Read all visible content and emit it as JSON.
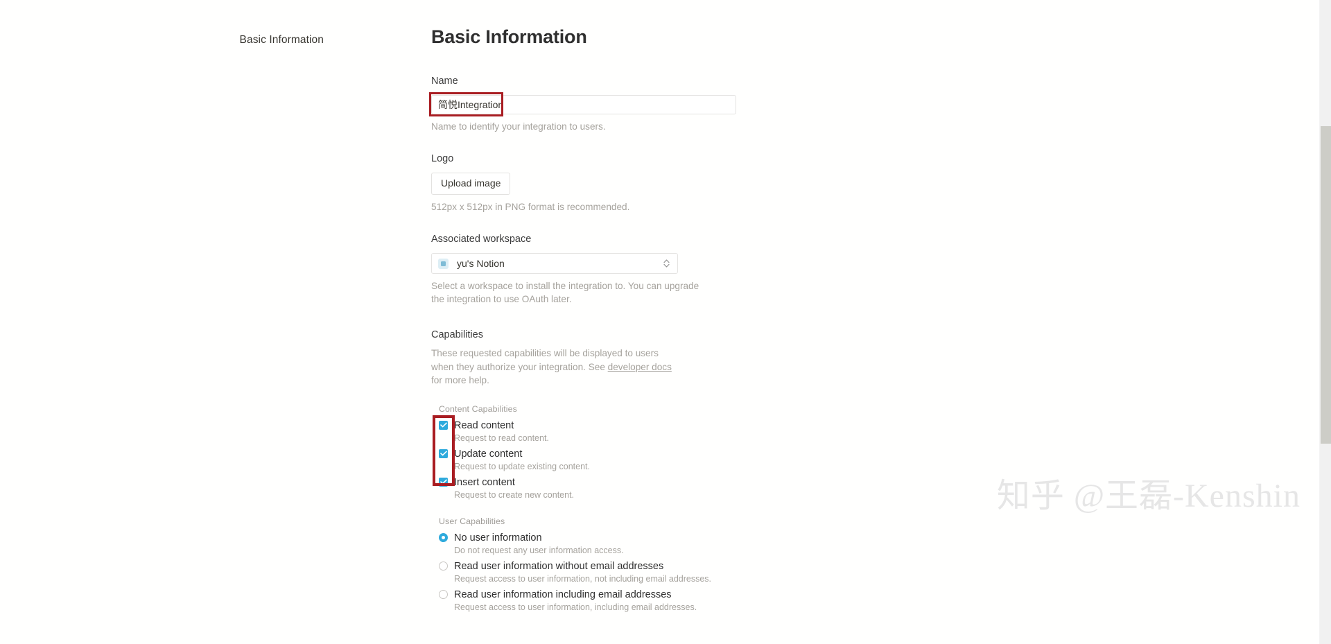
{
  "sidebar": {
    "items": [
      {
        "label": "Basic Information"
      }
    ]
  },
  "main": {
    "title": "Basic Information",
    "name_field": {
      "label": "Name",
      "value": "简悦Integration",
      "placeholder": "",
      "help": "Name to identify your integration to users."
    },
    "logo_field": {
      "label": "Logo",
      "button_label": "Upload image",
      "help": "512px x 512px in PNG format is recommended."
    },
    "workspace_field": {
      "label": "Associated workspace",
      "selected": "yu's Notion",
      "icon": "workspace-icon",
      "chevron": "chevron-updown-icon",
      "help_line1": "Select a workspace to install the integration to. You can upgrade",
      "help_line2": "the integration to use OAuth later."
    },
    "capabilities": {
      "heading": "Capabilities",
      "desc_part1": "These requested capabilities will be displayed to users when they",
      "desc_part2": "authorize your integration. See ",
      "desc_link": "developer docs",
      "desc_part3": " for more help.",
      "content_group": {
        "title": "Content Capabilities",
        "options": [
          {
            "label": "Read content",
            "sub": "Request to read content.",
            "checked": true
          },
          {
            "label": "Update content",
            "sub": "Request to update existing content.",
            "checked": true
          },
          {
            "label": "Insert content",
            "sub": "Request to create new content.",
            "checked": true
          }
        ]
      },
      "user_group": {
        "title": "User Capabilities",
        "options": [
          {
            "label": "No user information",
            "sub": "Do not request any user information access.",
            "selected": true
          },
          {
            "label": "Read user information without email addresses",
            "sub": "Request access to user information, not including email addresses.",
            "selected": false
          },
          {
            "label": "Read user information including email addresses",
            "sub": "Request access to user information, including email addresses.",
            "selected": false
          }
        ]
      }
    }
  },
  "watermark": {
    "text": "知乎 @王磊-Kenshin"
  },
  "colors": {
    "accent": "#2eaadc",
    "annotation": "#a91d22",
    "muted": "#a5a29c"
  }
}
